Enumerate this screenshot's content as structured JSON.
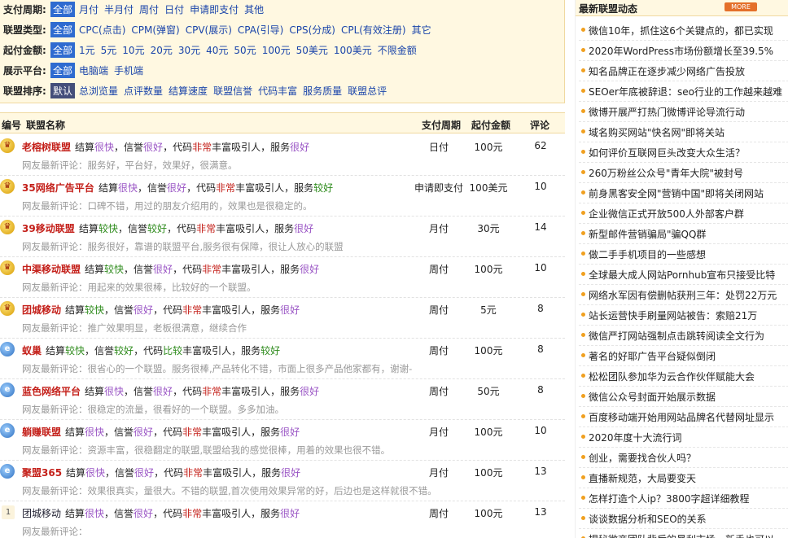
{
  "filters": [
    {
      "label": "支付周期:",
      "options": [
        "全部",
        "月付",
        "半月付",
        "周付",
        "日付",
        "申请即支付",
        "其他"
      ],
      "selected": 0
    },
    {
      "label": "联盟类型:",
      "options": [
        "全部",
        "CPC(点击)",
        "CPM(弹窗)",
        "CPV(展示)",
        "CPA(引导)",
        "CPS(分成)",
        "CPL(有效注册)",
        "其它"
      ],
      "selected": 0
    },
    {
      "label": "起付金额:",
      "options": [
        "全部",
        "1元",
        "5元",
        "10元",
        "20元",
        "30元",
        "40元",
        "50元",
        "100元",
        "50美元",
        "100美元",
        "不限金额"
      ],
      "selected": 0
    },
    {
      "label": "展示平台:",
      "options": [
        "全部",
        "电脑端",
        "手机端"
      ],
      "selected": 0
    },
    {
      "label": "联盟排序:",
      "options": [
        "默认",
        "总浏览量",
        "点评数量",
        "结算速度",
        "联盟信誉",
        "代码丰富",
        "服务质量",
        "联盟总评"
      ],
      "selected": 0
    }
  ],
  "table": {
    "headers": {
      "num": "编号",
      "name": "联盟名称",
      "pay": "支付周期",
      "min": "起付金额",
      "reviews": "评论"
    },
    "rows": [
      {
        "badge": "gold",
        "name": "老榕树联盟",
        "settle": "很快",
        "trust": "很好",
        "code": "非常",
        "service": "很好",
        "comment": "网友最新评论：服务好，平台好，效果好，很满意。",
        "pay": "日付",
        "min": "100元",
        "count": "62"
      },
      {
        "badge": "gold",
        "name": "35网络广告平台",
        "settle": "很快",
        "trust": "很好",
        "code": "非常",
        "service": "较好",
        "comment": "网友最新评论：口碑不错，用过的朋友介绍用的，效果也是很稳定的。",
        "pay": "申请即支付",
        "min": "100美元",
        "count": "10"
      },
      {
        "badge": "gold",
        "name": "39移动联盟",
        "settle": "较快",
        "trust": "较好",
        "code": "非常",
        "service": "很好",
        "comment": "网友最新评论：服务很好，靠谱的联盟平台,服务很有保障，很让人放心的联盟",
        "pay": "月付",
        "min": "30元",
        "count": "14"
      },
      {
        "badge": "gold",
        "name": "中渠移动联盟",
        "settle": "较快",
        "trust": "很好",
        "code": "非常",
        "service": "很好",
        "comment": "网友最新评论：用起来的效果很棒，比较好的一个联盟。",
        "pay": "周付",
        "min": "100元",
        "count": "10"
      },
      {
        "badge": "gold",
        "name": "团城移动",
        "settle": "较快",
        "trust": "很好",
        "code": "非常",
        "service": "很好",
        "comment": "网友最新评论：推广效果明显，老板很满意，继续合作",
        "pay": "周付",
        "min": "5元",
        "count": "8"
      },
      {
        "badge": "blue",
        "name": "蚁巢",
        "settle": "较快",
        "trust": "较好",
        "code": "比较",
        "service": "较好",
        "comment": "网友最新评论：很省心的一个联盟。服务很棒,产品转化不错，市面上很多产品他家都有，谢谢-",
        "pay": "周付",
        "min": "100元",
        "count": "8"
      },
      {
        "badge": "blue",
        "name": "蓝色网络平台",
        "settle": "很快",
        "trust": "很好",
        "code": "非常",
        "service": "很好",
        "comment": "网友最新评论：很稳定的流量，很看好的一个联盟。多多加油。",
        "pay": "周付",
        "min": "50元",
        "count": "8"
      },
      {
        "badge": "blue",
        "name": "躺赚联盟",
        "settle": "很快",
        "trust": "很好",
        "code": "非常",
        "service": "很好",
        "comment": "网友最新评论：资源丰富，很稳翻定的联盟,联盟给我的感觉很棒，用着的效果也很不错。",
        "pay": "月付",
        "min": "100元",
        "count": "10"
      },
      {
        "badge": "blue",
        "name": "聚盟365",
        "settle": "很快",
        "trust": "很好",
        "code": "非常",
        "service": "很好",
        "comment": "网友最新评论：效果很真实，量很大。不错的联盟,首次使用效果异常的好，后边也是这样就很不错。",
        "pay": "月付",
        "min": "100元",
        "count": "13"
      },
      {
        "badge": "num",
        "badge_text": "1",
        "name": "团城移动",
        "settle": "很快",
        "trust": "很好",
        "code": "非常",
        "service": "很好",
        "comment": "网友最新评论：",
        "pay": "周付",
        "min": "100元",
        "count": "13"
      }
    ],
    "words": {
      "settle": "结算",
      "trust": "，信誉",
      "code": "，代码",
      "rich": "丰富吸引人，服务"
    }
  },
  "sidebar": {
    "title": "最新联盟动态",
    "more": "MORE",
    "items": [
      "微信10年，抓住这6个关键点的，都已实现",
      "2020年WordPress市场份额增长至39.5%",
      "知名品牌正在逐步减少网络广告投放",
      "SEOer年底被辞退：seo行业的工作越来越难",
      "微博开展严打热门微博评论导流行动",
      "域名购买网站\"快名网\"即将关站",
      "如何评价互联网巨头改变大众生活？",
      "260万粉丝公众号\"青年大院\"被封号",
      "前身黑客安全网\"营销中国\"即将关闭网站",
      "企业微信正式开放500人外部客户群",
      "新型邮件营销骗局\"骗QQ群",
      "做二手手机项目的一些感想",
      "全球最大成人网站Pornhub宣布只接受比特",
      "网络水军因有偿删帖获刑三年：处罚22万元",
      "站长运营快手刷量网站被告：索赔21万",
      "微信严打网站强制点击跳转阅读全文行为",
      "著名的好耶广告平台疑似倒闭",
      "松松团队参加华为云合作伙伴赋能大会",
      "微信公众号封面开始展示数据",
      "百度移动端开始用网站品牌名代替网址显示",
      "2020年度十大流行词",
      "创业，需要找合伙人吗？",
      "直播新规范，大局要变天",
      "怎样打造个人ip？3800字超详细教程",
      "谈谈数据分析和SEO的关系",
      "揭秘微商团队背后的暴利市场，新手也可以"
    ]
  }
}
